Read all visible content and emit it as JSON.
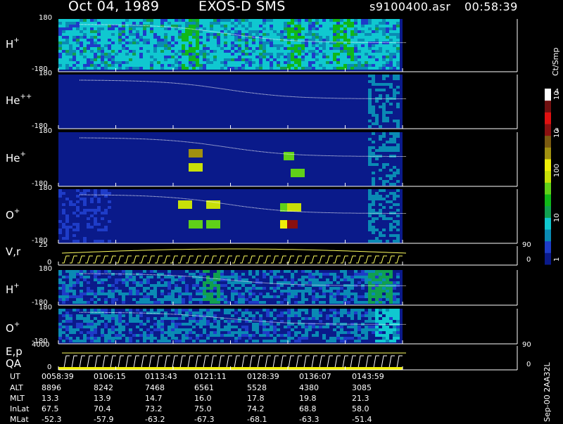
{
  "header": {
    "date": "Oct 04, 1989",
    "instrument": "EXOS-D SMS",
    "file": "s9100400.asr",
    "time": "00:58:39"
  },
  "colorbar": {
    "unit": "Ct/Smp",
    "scale": "log",
    "range": [
      1,
      10000
    ],
    "labels": [
      "1",
      "10",
      "100",
      "10",
      "3",
      "10",
      "4"
    ],
    "colors": [
      "#0a1a8a",
      "#1e3cc8",
      "#0a8ab4",
      "#10c8d0",
      "#10a050",
      "#10b818",
      "#60d018",
      "#c8e008",
      "#f0f008",
      "#a09010",
      "#7a5a10",
      "#8a1010",
      "#e01010",
      "#701010",
      "#ffffff"
    ]
  },
  "chart_data": {
    "type": "heatmap",
    "title": "Oct 04, 1989   EXOS-D SMS",
    "panels": [
      {
        "base": "H",
        "sup": "+",
        "ymax": "180",
        "ymin": "-180",
        "kind": "spectrogram"
      },
      {
        "base": "He",
        "sup": "++",
        "ymax": "180",
        "ymin": "-180",
        "kind": "spectrogram"
      },
      {
        "base": "He",
        "sup": "+",
        "ymax": "180",
        "ymin": "-180",
        "kind": "spectrogram"
      },
      {
        "base": "O",
        "sup": "+",
        "ymax": "180",
        "ymin": "-180",
        "kind": "spectrogram"
      },
      {
        "base": "V,r",
        "sup": "",
        "ymax": "25",
        "ymin": "0",
        "kind": "line",
        "right_max": "90",
        "right_min": "0"
      },
      {
        "base": "H",
        "sup": "+",
        "ymax": "180",
        "ymin": "-180",
        "kind": "spectrogram"
      },
      {
        "base": "O",
        "sup": "+",
        "ymax": "180",
        "ymin": "-180",
        "kind": "spectrogram"
      },
      {
        "base": "E,p",
        "sup": "",
        "base2": "QA",
        "ymax": "4000",
        "ymin": "0",
        "kind": "line",
        "right_max": "90",
        "right_min": "0"
      }
    ],
    "x_ticks": [
      "0058:39",
      "0106:15",
      "0113:43",
      "0121:11",
      "0128:39",
      "0136:07",
      "0143:59"
    ],
    "rows": [
      {
        "label": "UT",
        "values": [
          "0058:39",
          "0106:15",
          "0113:43",
          "0121:11",
          "0128:39",
          "0136:07",
          "0143:59"
        ]
      },
      {
        "label": "ALT",
        "values": [
          "8896",
          "8242",
          "7468",
          "6561",
          "5528",
          "4380",
          "3085"
        ]
      },
      {
        "label": "MLT",
        "values": [
          "13.3",
          "13.9",
          "14.7",
          "16.0",
          "17.8",
          "19.8",
          "21.3"
        ]
      },
      {
        "label": "InLat",
        "values": [
          "67.5",
          "70.4",
          "73.2",
          "75.0",
          "74.2",
          "68.8",
          "58.0"
        ]
      },
      {
        "label": "MLat",
        "values": [
          "-52.3",
          "-57.9",
          "-63.2",
          "-67.3",
          "-68.1",
          "-63.3",
          "-51.4"
        ]
      }
    ],
    "footer_tag": "Sep-00  2AA32L"
  }
}
